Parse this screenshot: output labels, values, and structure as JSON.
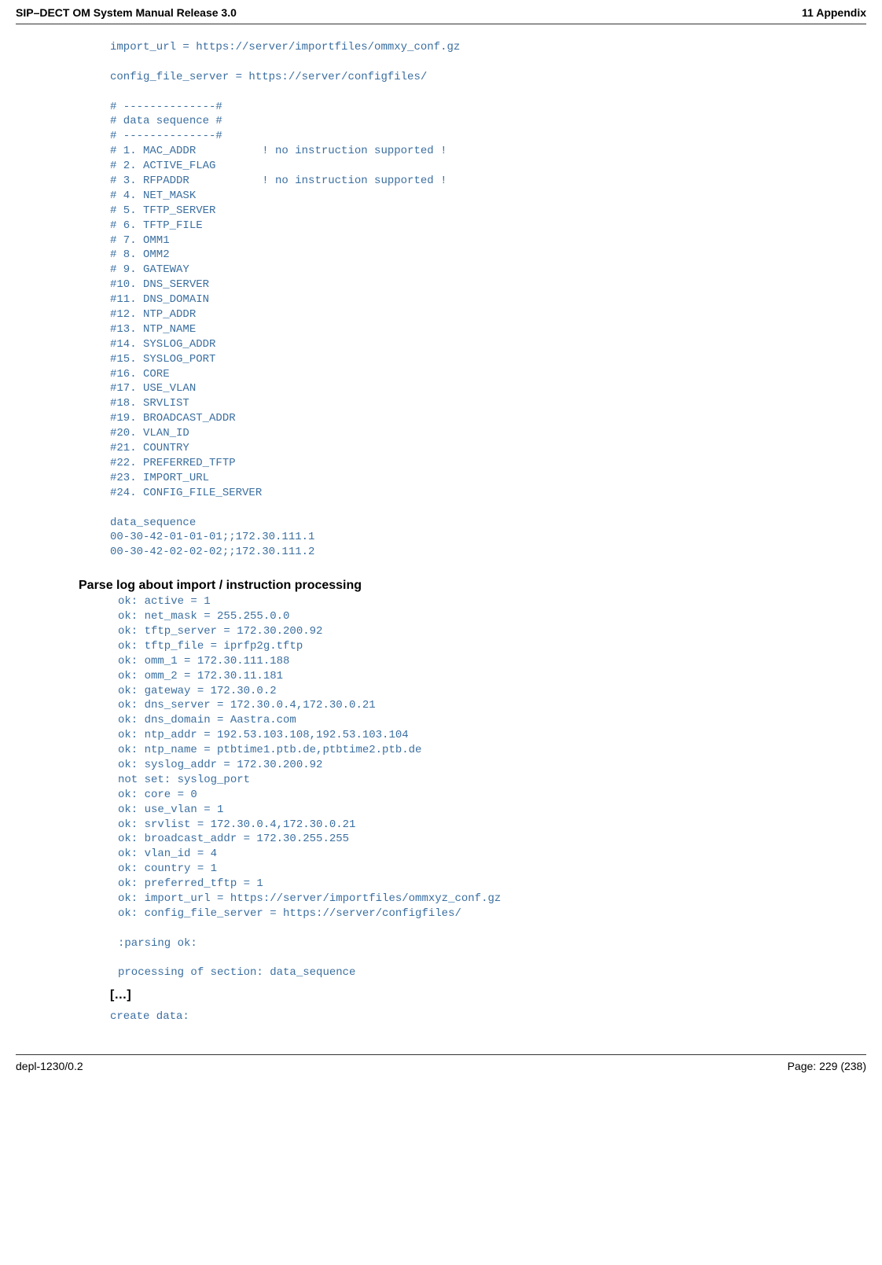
{
  "header": {
    "left": "SIP–DECT OM System Manual Release 3.0",
    "right": "11 Appendix"
  },
  "code1": "import_url = https://server/importfiles/ommxy_conf.gz\n\nconfig_file_server = https://server/configfiles/\n\n# --------------#\n# data sequence #\n# --------------#\n# 1. MAC_ADDR          ! no instruction supported !\n# 2. ACTIVE_FLAG\n# 3. RFPADDR           ! no instruction supported !\n# 4. NET_MASK\n# 5. TFTP_SERVER\n# 6. TFTP_FILE\n# 7. OMM1\n# 8. OMM2\n# 9. GATEWAY\n#10. DNS_SERVER\n#11. DNS_DOMAIN\n#12. NTP_ADDR\n#13. NTP_NAME\n#14. SYSLOG_ADDR\n#15. SYSLOG_PORT\n#16. CORE\n#17. USE_VLAN\n#18. SRVLIST\n#19. BROADCAST_ADDR\n#20. VLAN_ID\n#21. COUNTRY\n#22. PREFERRED_TFTP\n#23. IMPORT_URL\n#24. CONFIG_FILE_SERVER\n\ndata_sequence\n00-30-42-01-01-01;;172.30.111.1\n00-30-42-02-02-02;;172.30.111.2",
  "heading": "Parse log about import / instruction processing",
  "log": "ok: active = 1\nok: net_mask = 255.255.0.0\nok: tftp_server = 172.30.200.92\nok: tftp_file = iprfp2g.tftp\nok: omm_1 = 172.30.111.188\nok: omm_2 = 172.30.11.181\nok: gateway = 172.30.0.2\nok: dns_server = 172.30.0.4,172.30.0.21\nok: dns_domain = Aastra.com\nok: ntp_addr = 192.53.103.108,192.53.103.104\nok: ntp_name = ptbtime1.ptb.de,ptbtime2.ptb.de\nok: syslog_addr = 172.30.200.92\nnot set: syslog_port\nok: core = 0\nok: use_vlan = 1\nok: srvlist = 172.30.0.4,172.30.0.21\nok: broadcast_addr = 172.30.255.255\nok: vlan_id = 4\nok: country = 1\nok: preferred_tftp = 1\nok: import_url = https://server/importfiles/ommxyz_conf.gz\nok: config_file_server = https://server/configfiles/\n\n:parsing ok:\n\nprocessing of section: data_sequence",
  "ellipsis": "[…]",
  "create_data": "create data:",
  "footer": {
    "left": "depl-1230/0.2",
    "right": "Page: 229 (238)"
  }
}
